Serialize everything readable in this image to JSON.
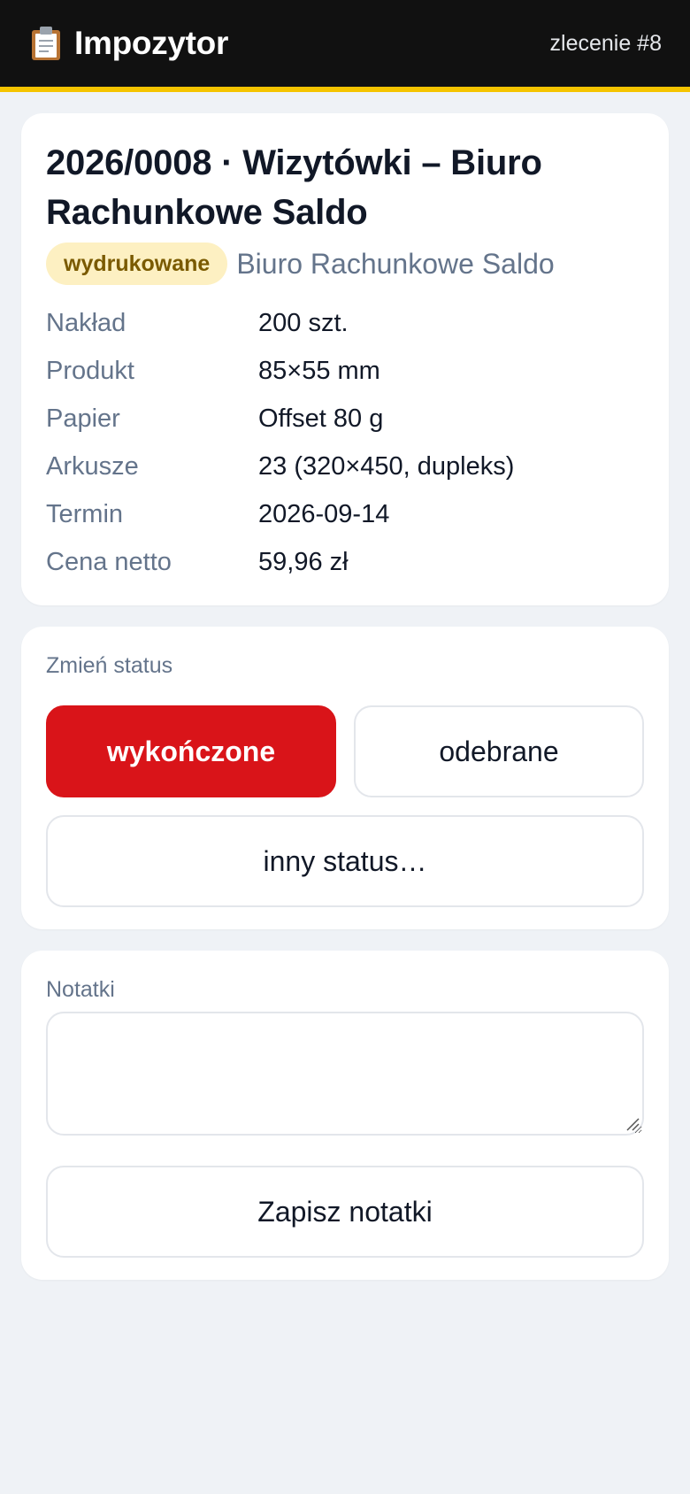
{
  "header": {
    "app_icon": "clipboard-icon",
    "app_title": "Impozytor",
    "order_ref": "zlecenie #8"
  },
  "order": {
    "title": "2026/0008 · Wizytówki – Biuro Rachunkowe Saldo",
    "status_badge": "wydrukowane",
    "client": "Biuro Rachunkowe Saldo",
    "details": [
      {
        "label": "Nakład",
        "value": "200 szt."
      },
      {
        "label": "Produkt",
        "value": "85×55 mm"
      },
      {
        "label": "Papier",
        "value": "Offset 80 g"
      },
      {
        "label": "Arkusze",
        "value": "23 (320×450, dupleks)"
      },
      {
        "label": "Termin",
        "value": "2026-09-14"
      },
      {
        "label": "Cena netto",
        "value": "59,96 zł"
      }
    ]
  },
  "status_section": {
    "label": "Zmień status",
    "primary_button": "wykończone",
    "secondary_button": "odebrane",
    "other_button": "inny status…"
  },
  "notes_section": {
    "label": "Notatki",
    "value": "",
    "save_button": "Zapisz notatki"
  },
  "colors": {
    "accent_yellow": "#f5c400",
    "primary_red": "#d91419",
    "badge_bg": "#fdf0c2",
    "badge_text": "#7a5a00"
  }
}
